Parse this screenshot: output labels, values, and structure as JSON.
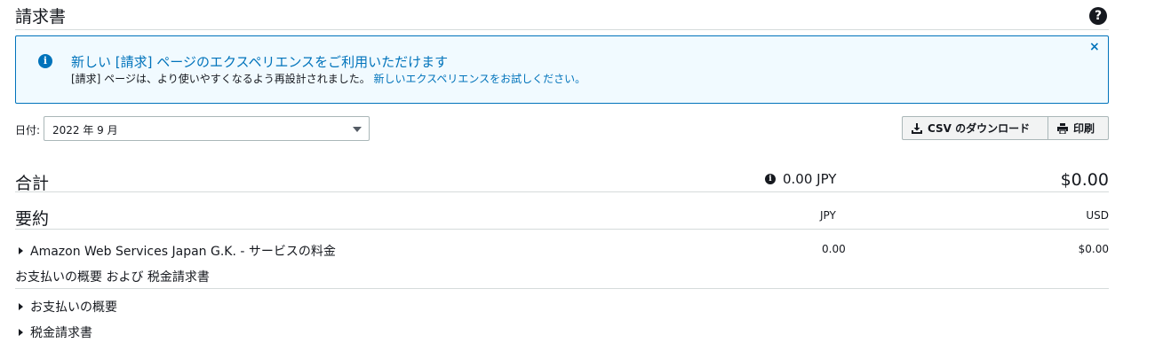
{
  "header": {
    "title": "請求書",
    "help_icon": "?"
  },
  "banner": {
    "icon": "i",
    "title": "新しい [請求] ページのエクスペリエンスをご利用いただけます",
    "body": "[請求] ページは、より使いやすくなるよう再設計されました。",
    "link": "新しいエクスペリエンスをお試しください。",
    "close": "×"
  },
  "date": {
    "label": "日付:",
    "value": "2022 年 9 月"
  },
  "actions": {
    "csv": "CSV のダウンロード",
    "print": "印刷"
  },
  "total": {
    "label": "合計",
    "jpy": "0.00 JPY",
    "usd": "$0.00"
  },
  "summary": {
    "label": "要約",
    "col_jpy": "JPY",
    "col_usd": "USD",
    "rows": [
      {
        "label": "Amazon Web Services Japan G.K. - サービスの料金",
        "jpy": "0.00",
        "usd": "$0.00"
      }
    ]
  },
  "payments": {
    "heading": "お支払いの概要 および 税金請求書",
    "items": [
      {
        "label": "お支払いの概要"
      },
      {
        "label": "税金請求書"
      }
    ]
  },
  "colors": {
    "accent": "#0073bb",
    "banner_bg": "#f1faff",
    "border": "#d5dbdb"
  }
}
